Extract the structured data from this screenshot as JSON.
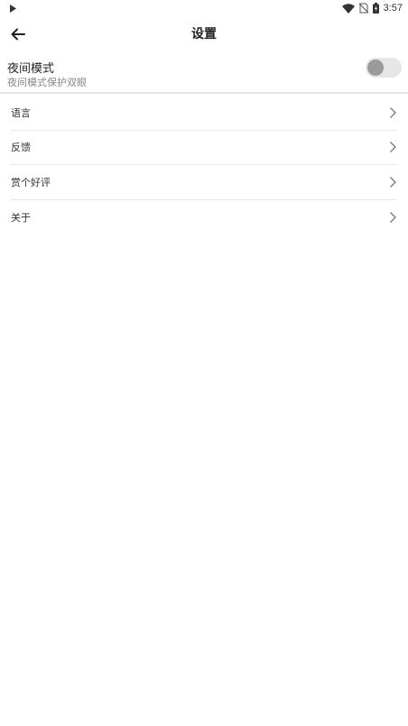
{
  "status_bar": {
    "time": "3:57",
    "icons": [
      "play-icon",
      "wifi-icon",
      "no-sim-icon",
      "battery-charging-icon"
    ]
  },
  "toolbar": {
    "title": "设置",
    "back_icon": "arrow-left-icon"
  },
  "night_mode": {
    "title": "夜间模式",
    "subtitle": "夜间模式保护双眼",
    "enabled": false
  },
  "menu": {
    "items": [
      {
        "label": "语言"
      },
      {
        "label": "反馈"
      },
      {
        "label": "赏个好评"
      },
      {
        "label": "关于"
      }
    ],
    "chevron_icon": "chevron-right-icon"
  },
  "colors": {
    "background": "#ffffff",
    "divider": "#e4e4e4",
    "toggle_track": "#e6e6e6",
    "toggle_knob": "#9a9a9a",
    "subtitle": "#888888"
  }
}
